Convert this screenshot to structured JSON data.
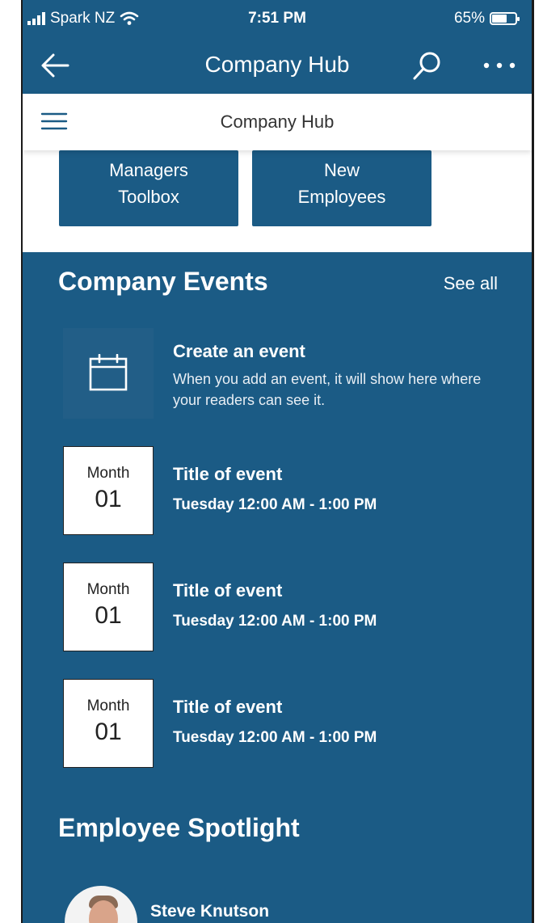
{
  "status_bar": {
    "carrier": "Spark NZ",
    "time": "7:51 PM",
    "battery": "65%",
    "battery_level": 0.65
  },
  "app_header": {
    "title": "Company Hub",
    "icons": [
      "back-arrow-icon",
      "search-icon",
      "more-icon"
    ]
  },
  "site_header": {
    "title": "Company Hub",
    "icons": [
      "hamburger-menu-icon"
    ]
  },
  "quick_links": [
    {
      "line1": "Managers",
      "line2": "Toolbox"
    },
    {
      "line1": "New",
      "line2": "Employees"
    }
  ],
  "events": {
    "title": "Company Events",
    "see_all": "See all",
    "create": {
      "title": "Create an event",
      "description": "When you add an event, it will show here where your readers can see it."
    },
    "items": [
      {
        "month": "Month",
        "day": "01",
        "title": "Title of event",
        "time": "Tuesday 12:00 AM - 1:00 PM"
      },
      {
        "month": "Month",
        "day": "01",
        "title": "Title of event",
        "time": "Tuesday 12:00 AM - 1:00 PM"
      },
      {
        "month": "Month",
        "day": "01",
        "title": "Title of event",
        "time": "Tuesday 12:00 AM - 1:00 PM"
      }
    ]
  },
  "spotlight": {
    "title": "Employee Spotlight",
    "people": [
      {
        "name": "Steve Knutson"
      }
    ]
  },
  "colors": {
    "theme": "#1b5b85",
    "create_tile": "#225e87",
    "white": "#ffffff"
  }
}
